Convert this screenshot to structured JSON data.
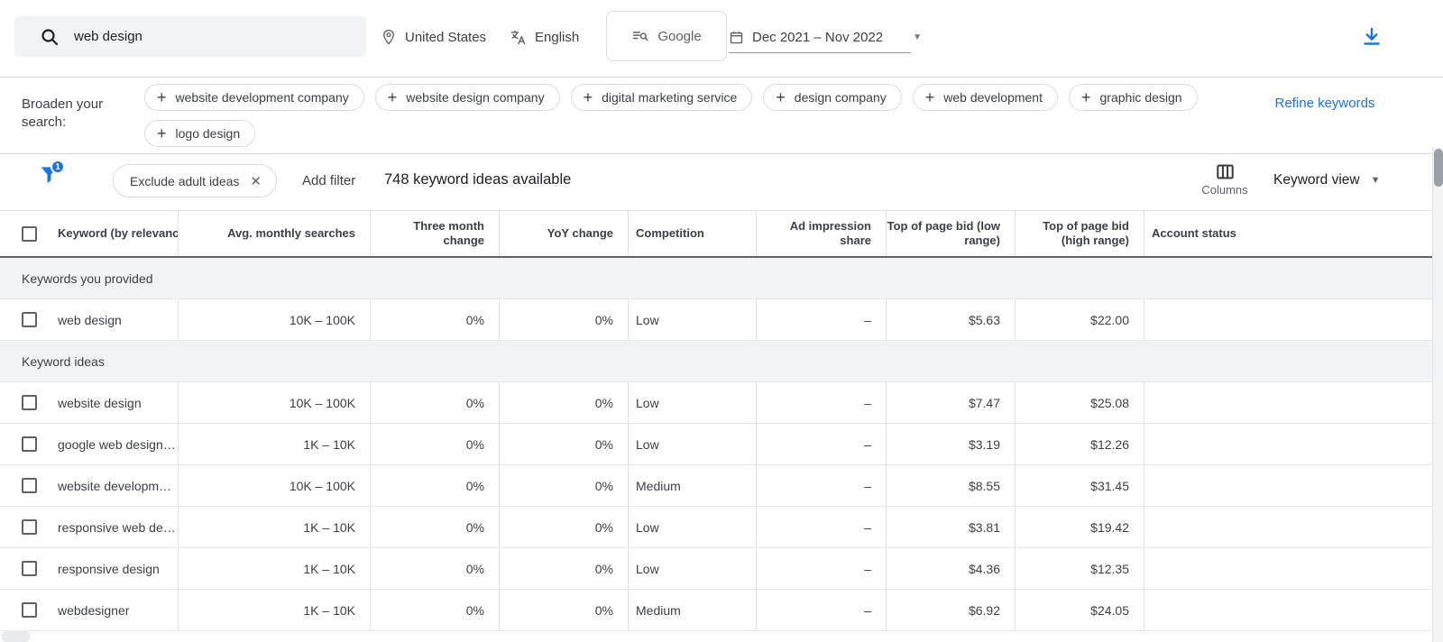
{
  "topbar": {
    "search": {
      "value": "web design"
    },
    "location": "United States",
    "language": "English",
    "network": "Google",
    "date_range": "Dec 2021 – Nov 2022"
  },
  "broaden": {
    "label": "Broaden your search:",
    "chip_rows": [
      [
        "website development company",
        "website design company",
        "digital marketing service",
        "design company",
        "web development",
        "graphic design"
      ],
      [
        "logo design"
      ]
    ],
    "refine_link": "Refine keywords"
  },
  "filterbar": {
    "filter_count": "1",
    "active_filter": "Exclude adult ideas",
    "add_filter": "Add filter",
    "results_summary": "748 keyword ideas available",
    "columns_label": "Columns",
    "view_selector": "Keyword view"
  },
  "table": {
    "headers": [
      "Keyword (by relevance)",
      "Avg. monthly searches",
      "Three month change",
      "YoY change",
      "Competition",
      "Ad impression share",
      "Top of page bid (low range)",
      "Top of page bid (high range)",
      "Account status"
    ],
    "sections": [
      {
        "label": "Keywords you provided",
        "rows": [
          {
            "keyword": "web design",
            "avg_monthly_searches": "10K – 100K",
            "three_month_change": "0%",
            "yoy_change": "0%",
            "competition": "Low",
            "ad_impression_share": "–",
            "top_bid_low": "$5.63",
            "top_bid_high": "$22.00",
            "account_status": ""
          }
        ]
      },
      {
        "label": "Keyword ideas",
        "rows": [
          {
            "keyword": "website design",
            "avg_monthly_searches": "10K – 100K",
            "three_month_change": "0%",
            "yoy_change": "0%",
            "competition": "Low",
            "ad_impression_share": "–",
            "top_bid_low": "$7.47",
            "top_bid_high": "$25.08",
            "account_status": ""
          },
          {
            "keyword": "google web design…",
            "avg_monthly_searches": "1K – 10K",
            "three_month_change": "0%",
            "yoy_change": "0%",
            "competition": "Low",
            "ad_impression_share": "–",
            "top_bid_low": "$3.19",
            "top_bid_high": "$12.26",
            "account_status": ""
          },
          {
            "keyword": "website developm…",
            "avg_monthly_searches": "10K – 100K",
            "three_month_change": "0%",
            "yoy_change": "0%",
            "competition": "Medium",
            "ad_impression_share": "–",
            "top_bid_low": "$8.55",
            "top_bid_high": "$31.45",
            "account_status": ""
          },
          {
            "keyword": "responsive web de…",
            "avg_monthly_searches": "1K – 10K",
            "three_month_change": "0%",
            "yoy_change": "0%",
            "competition": "Low",
            "ad_impression_share": "–",
            "top_bid_low": "$3.81",
            "top_bid_high": "$19.42",
            "account_status": ""
          },
          {
            "keyword": "responsive design",
            "avg_monthly_searches": "1K – 10K",
            "three_month_change": "0%",
            "yoy_change": "0%",
            "competition": "Low",
            "ad_impression_share": "–",
            "top_bid_low": "$4.36",
            "top_bid_high": "$12.35",
            "account_status": ""
          },
          {
            "keyword": "webdesigner",
            "avg_monthly_searches": "1K – 10K",
            "three_month_change": "0%",
            "yoy_change": "0%",
            "competition": "Medium",
            "ad_impression_share": "–",
            "top_bid_low": "$6.92",
            "top_bid_high": "$24.05",
            "account_status": ""
          }
        ]
      }
    ]
  },
  "icons": {
    "plus": "+",
    "close": "✕",
    "caret_down": "▼",
    "names": [
      "search-icon",
      "location-pin-icon",
      "translate-icon",
      "search-network-icon",
      "calendar-icon",
      "download-icon",
      "filter-funnel-icon",
      "close-icon",
      "columns-icon",
      "caret-down-icon"
    ]
  },
  "colors": {
    "accent": "#1a73e8",
    "section_bg": "#f1f3f4",
    "text_dark": "#202124",
    "text_gray": "#5f6368"
  }
}
